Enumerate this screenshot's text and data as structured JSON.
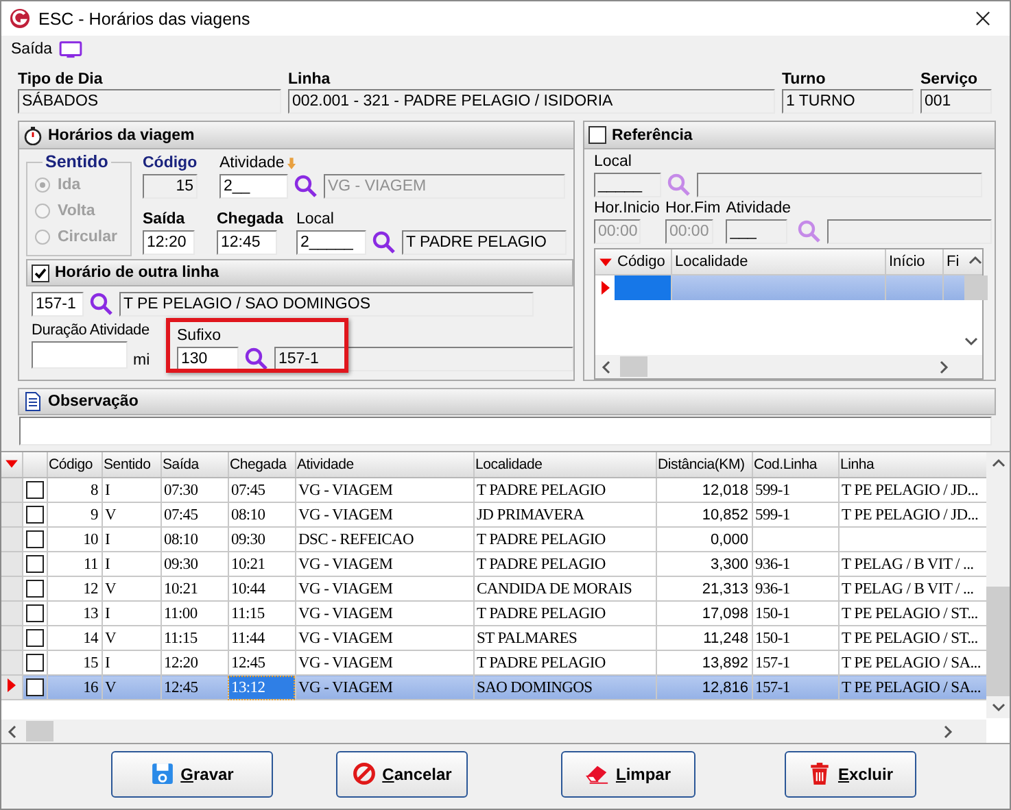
{
  "window": {
    "title": "ESC - Horários das viagens"
  },
  "menu": [
    {
      "label": "Saída"
    }
  ],
  "header": [
    {
      "label": "Tipo de Dia",
      "value": "SÁBADOS"
    },
    {
      "label": "Linha",
      "value": "002.001 - 321 - PADRE PELAGIO / ISIDORIA"
    },
    {
      "label": "Turno",
      "value": "1 TURNO"
    },
    {
      "label": "Serviço",
      "value": "001"
    }
  ],
  "trip": {
    "title": "Horários da viagem",
    "sentido": {
      "label": "Sentido",
      "disabled": true,
      "options": [
        {
          "label": "Ida",
          "selected": true
        },
        {
          "label": "Volta",
          "selected": false
        },
        {
          "label": "Circular",
          "selected": false
        }
      ]
    },
    "codigo": {
      "label": "Código",
      "value": "15"
    },
    "atividade": {
      "label": "Atividade",
      "value": "2__",
      "description": "VG  - VIAGEM"
    },
    "saida": {
      "label": "Saída",
      "value": "12:20"
    },
    "chegada": {
      "label": "Chegada",
      "value": "12:45"
    },
    "local": {
      "label": "Local",
      "value": "2_____",
      "description": "T PADRE PELAGIO"
    }
  },
  "other_line": {
    "label": "Horário de outra linha",
    "checked": true,
    "code": "157-1",
    "description": "T PE PELAGIO / SAO DOMINGOS"
  },
  "duration": {
    "label": "Duração Atividade",
    "unit": "mi"
  },
  "suffix": {
    "label": "Sufixo",
    "value": "130",
    "description": "157-1",
    "highlighted": true
  },
  "reference": {
    "label": "Referência",
    "checked": false,
    "local": {
      "label": "Local",
      "value": "_____"
    },
    "hor_inicio": {
      "label": "Hor.Inicio",
      "value": "00:00"
    },
    "hor_fim": {
      "label": "Hor.Fim",
      "value": "00:00"
    },
    "atividade": {
      "label": "Atividade",
      "value": "___"
    },
    "columns": [
      "Código",
      "Localidade",
      "Início",
      "Fi"
    ],
    "rows": [
      {
        "selected": true
      }
    ]
  },
  "observation": {
    "label": "Observação"
  },
  "table": {
    "columns": [
      {
        "label": "Código",
        "focused": false
      },
      {
        "label": "Sentido",
        "focused": false
      },
      {
        "label": "Saída",
        "focused": false
      },
      {
        "label": "Chegada",
        "focused": true
      },
      {
        "label": "Atividade",
        "focused": false
      },
      {
        "label": "Localidade",
        "focused": false
      },
      {
        "label": "Distância(KM)",
        "focused": false
      },
      {
        "label": "Cod.Linha",
        "focused": false
      },
      {
        "label": "Linha",
        "focused": false
      }
    ],
    "rows": [
      {
        "checked": false,
        "selected": false,
        "cells": [
          "8",
          "I",
          "07:30",
          "07:45",
          "VG  - VIAGEM",
          "T PADRE PELAGIO",
          "12,018",
          "599-1",
          "T PE PELAGIO / JD..."
        ]
      },
      {
        "checked": false,
        "selected": false,
        "cells": [
          "9",
          "V",
          "07:45",
          "08:10",
          "VG  - VIAGEM",
          "JD PRIMAVERA",
          "10,852",
          "599-1",
          "T PE PELAGIO / JD..."
        ]
      },
      {
        "checked": false,
        "selected": false,
        "cells": [
          "10",
          "I",
          "08:10",
          "09:30",
          "DSC - REFEICAO",
          "T PADRE PELAGIO",
          "0,000",
          null,
          null
        ]
      },
      {
        "checked": false,
        "selected": false,
        "cells": [
          "11",
          "I",
          "09:30",
          "10:21",
          "VG  - VIAGEM",
          "T PADRE PELAGIO",
          "3,300",
          "936-1",
          "T PELAG / B VIT / ..."
        ]
      },
      {
        "checked": false,
        "selected": false,
        "cells": [
          "12",
          "V",
          "10:21",
          "10:44",
          "VG  - VIAGEM",
          "CANDIDA DE MORAIS",
          "21,313",
          "936-1",
          "T PELAG / B VIT / ..."
        ]
      },
      {
        "checked": false,
        "selected": false,
        "cells": [
          "13",
          "I",
          "11:00",
          "11:15",
          "VG  - VIAGEM",
          "T PADRE PELAGIO",
          "17,098",
          "150-1",
          "T PE PELAGIO / ST..."
        ]
      },
      {
        "checked": false,
        "selected": false,
        "cells": [
          "14",
          "V",
          "11:15",
          "11:44",
          "VG  - VIAGEM",
          "ST PALMARES",
          "11,248",
          "150-1",
          "T PE PELAGIO / ST..."
        ]
      },
      {
        "checked": false,
        "selected": false,
        "cells": [
          "15",
          "I",
          "12:20",
          "12:45",
          "VG  - VIAGEM",
          "T PADRE PELAGIO",
          "13,892",
          "157-1",
          "T PE PELAGIO / SA..."
        ]
      },
      {
        "checked": false,
        "selected": true,
        "cells": [
          "16",
          "V",
          "12:45",
          "13:12",
          "VG  - VIAGEM",
          "SAO DOMINGOS",
          "12,816",
          "157-1",
          "T PE PELAGIO / SA..."
        ]
      }
    ]
  },
  "buttons": [
    {
      "label": "Gravar",
      "kind": "save"
    },
    {
      "label": "Cancelar",
      "kind": "cancel"
    },
    {
      "label": "Limpar",
      "kind": "clear"
    },
    {
      "label": "Excluir",
      "kind": "delete"
    }
  ]
}
